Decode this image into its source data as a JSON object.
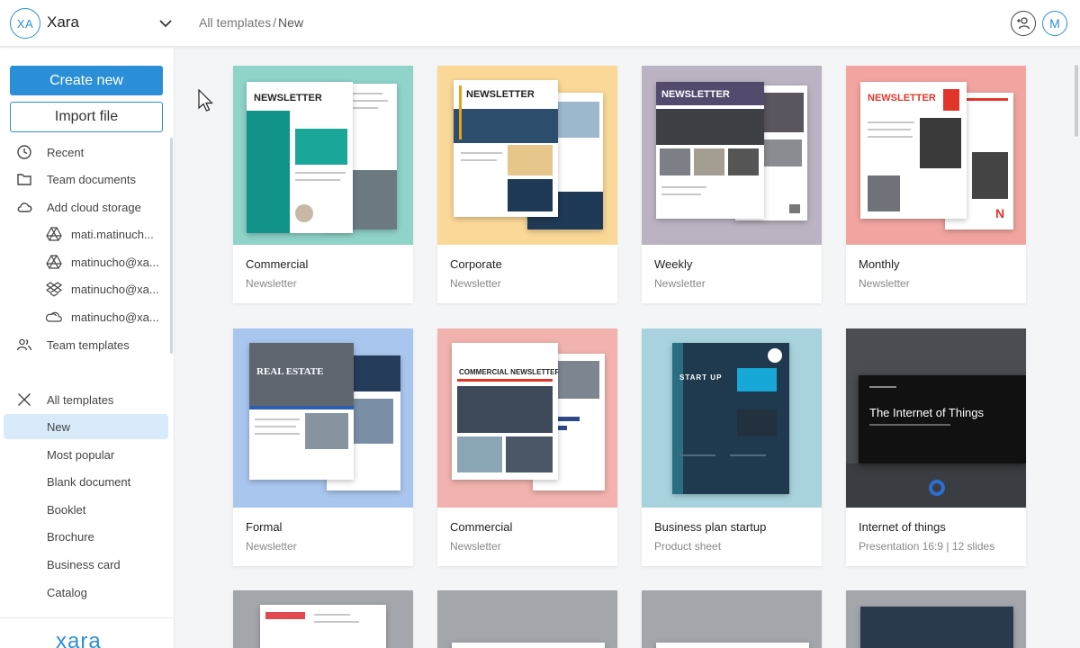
{
  "header": {
    "workspace_initials": "XA",
    "workspace_name": "Xara",
    "breadcrumb_root": "All templates",
    "breadcrumb_sep": "/",
    "breadcrumb_current": "New",
    "user_initial": "M"
  },
  "sidebar": {
    "create_label": "Create new",
    "import_label": "Import file",
    "items": [
      {
        "label": "Recent",
        "icon": "clock-icon"
      },
      {
        "label": "Team documents",
        "icon": "folder-icon"
      },
      {
        "label": "Add cloud storage",
        "icon": "cloud-icon"
      },
      {
        "label": "mati.matinuch...",
        "icon": "google-drive-icon"
      },
      {
        "label": "matinucho@xa...",
        "icon": "google-drive-icon"
      },
      {
        "label": "matinucho@xa...",
        "icon": "dropbox-icon"
      },
      {
        "label": "matinucho@xa...",
        "icon": "onedrive-icon"
      },
      {
        "label": "Team templates",
        "icon": "team-icon"
      },
      {
        "label": "All templates",
        "icon": "tools-icon"
      },
      {
        "label": "New",
        "icon": ""
      },
      {
        "label": "Most popular",
        "icon": ""
      },
      {
        "label": "Blank document",
        "icon": ""
      },
      {
        "label": "Booklet",
        "icon": ""
      },
      {
        "label": "Brochure",
        "icon": ""
      },
      {
        "label": "Business card",
        "icon": ""
      },
      {
        "label": "Catalog",
        "icon": ""
      }
    ],
    "active_item": "New",
    "logo_text": "xara"
  },
  "templates": [
    {
      "title": "Commercial",
      "subtitle": "Newsletter",
      "bg": "#8fd3c9",
      "masthead": "NEWSLETTER"
    },
    {
      "title": "Corporate",
      "subtitle": "Newsletter",
      "bg": "#fbd897",
      "masthead": "NEWSLETTER"
    },
    {
      "title": "Weekly",
      "subtitle": "Newsletter",
      "bg": "#bcb3c2",
      "masthead": "NEWSLETTER"
    },
    {
      "title": "Monthly",
      "subtitle": "Newsletter",
      "bg": "#f2a5a0",
      "masthead": "NEWSLETTER"
    },
    {
      "title": "Formal",
      "subtitle": "Newsletter",
      "bg": "#a9c6ee",
      "masthead": "REAL ESTATE"
    },
    {
      "title": "Commercial",
      "subtitle": "Newsletter",
      "bg": "#f2b3ae",
      "masthead": "COMMERCIAL NEWSLETTER"
    },
    {
      "title": "Business plan startup",
      "subtitle": "Product sheet",
      "bg": "#a8d3de",
      "masthead": "START UP"
    },
    {
      "title": "Internet of things",
      "subtitle": "Presentation 16:9 | 12 slides",
      "bg": "#4a4d52",
      "masthead": "The Internet of Things"
    }
  ],
  "colors": {
    "accent": "#2b8fd8",
    "active_bg": "#d9ebfa"
  }
}
